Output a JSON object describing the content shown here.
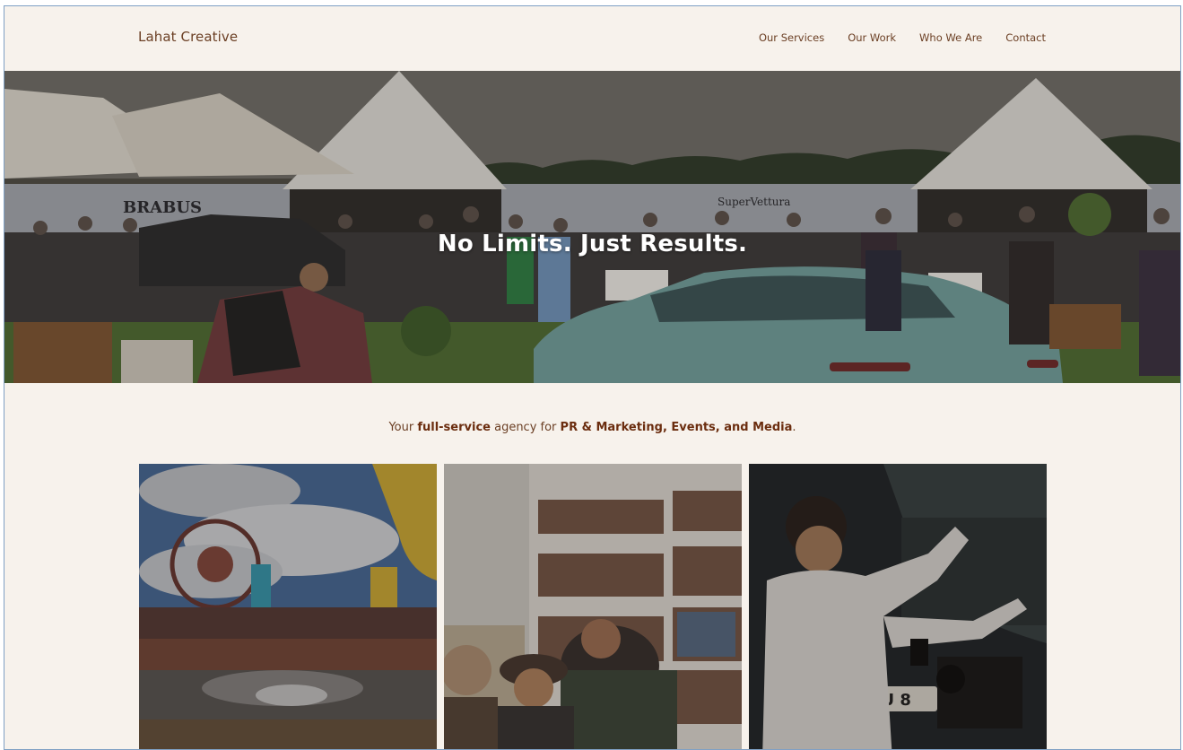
{
  "header": {
    "logo": "Lahat Creative",
    "nav": [
      {
        "label": "Our Services"
      },
      {
        "label": "Our Work"
      },
      {
        "label": "Who We Are"
      },
      {
        "label": "Contact"
      }
    ]
  },
  "hero": {
    "title": "No Limits. Just Results.",
    "signage": {
      "left": "BRABUS",
      "right": "SuperVettura"
    }
  },
  "tagline": {
    "prefix": "Your ",
    "strong_1": "full-service",
    "middle": " agency for ",
    "strong_2": "PR & Marketing, Events, and Media",
    "suffix": "."
  },
  "cards": [
    {
      "scene": "event-racing-photo"
    },
    {
      "scene": "team-library-photo"
    },
    {
      "scene": "film-production-photo"
    }
  ],
  "colors": {
    "background": "#f7f2ec",
    "text_brown": "#6b3f24",
    "accent_brown": "#6b2d0f"
  }
}
